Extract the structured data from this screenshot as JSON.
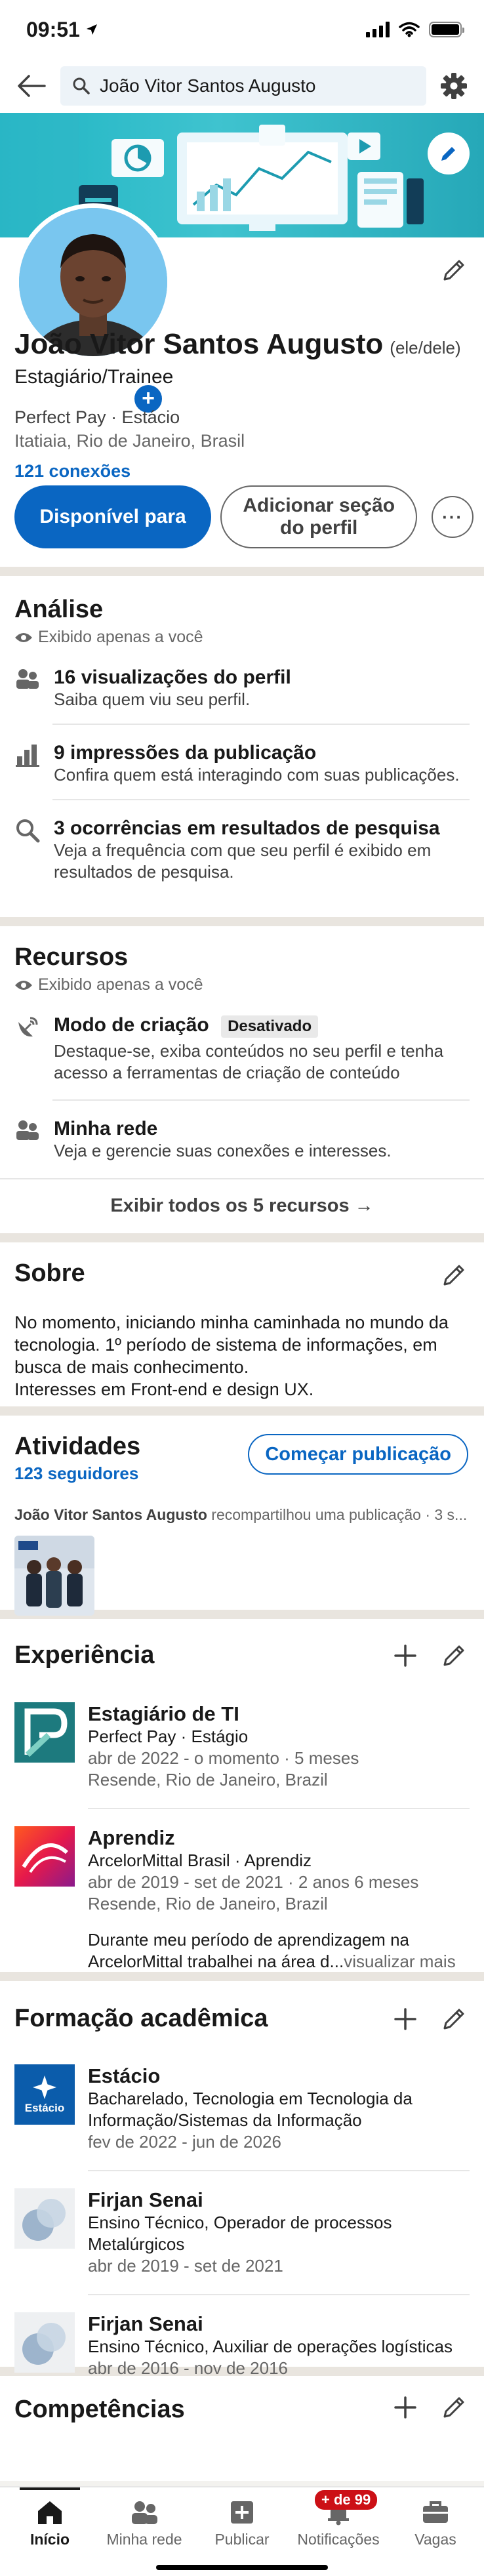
{
  "status_bar": {
    "time": "09:51"
  },
  "search": {
    "value": "João Vitor Santos Augusto"
  },
  "profile": {
    "name": "João Vitor Santos Augusto",
    "pronouns": "(ele/dele)",
    "headline": "Estagiário/Trainee",
    "company_school": "Perfect Pay · Estácio",
    "location": "Itatiaia, Rio de Janeiro, Brasil",
    "connections": "121 conexões",
    "open_to_button": "Disponível para",
    "add_section_button": "Adicionar seção do perfil"
  },
  "analytics": {
    "title": "Análise",
    "private_note": "Exibido apenas a você",
    "items": [
      {
        "title": "16 visualizações do perfil",
        "subtitle": "Saiba quem viu seu perfil."
      },
      {
        "title": "9 impressões da publicação",
        "subtitle": "Confira quem está interagindo com suas publicações."
      },
      {
        "title": "3 ocorrências em resultados de pesquisa",
        "subtitle": "Veja a frequência com que seu perfil é exibido em resultados de pesquisa."
      }
    ]
  },
  "resources": {
    "title": "Recursos",
    "private_note": "Exibido apenas a você",
    "creator_title": "Modo de criação",
    "creator_badge": "Desativado",
    "creator_sub": "Destaque-se, exiba conteúdos no seu perfil e tenha acesso a ferramentas de criação de conteúdo",
    "network_title": "Minha rede",
    "network_sub": "Veja e gerencie suas conexões e interesses.",
    "show_all": "Exibir todos os 5 recursos →"
  },
  "about": {
    "title": "Sobre",
    "text": "No momento, iniciando minha caminhada no mundo da tecnologia. 1º período de sistema de informações, em busca de mais conhecimento.",
    "text2": "Interesses em Front-end e design UX."
  },
  "activity": {
    "title": "Atividades",
    "followers": "123 seguidores",
    "start_post": "Começar publicação",
    "actor": "João Vitor Santos Augusto",
    "action": " recompartilhou uma publicação · 3 s..."
  },
  "experience": {
    "title": "Experiência",
    "items": [
      {
        "title": "Estagiário de TI",
        "company": "Perfect Pay · Estágio",
        "dates": "abr de 2022 - o momento · 5 meses",
        "location": "Resende, Rio de Janeiro, Brazil"
      },
      {
        "title": "Aprendiz",
        "company": "ArcelorMittal Brasil · Aprendiz",
        "dates": "abr de 2019 - set de 2021 · 2 anos 6 meses",
        "location": "Resende, Rio de Janeiro, Brazil",
        "description": "Durante meu período de aprendizagem na ArcelorMittal trabalhei na área d...",
        "see_more": "visualizar mais"
      }
    ]
  },
  "education": {
    "title": "Formação acadêmica",
    "items": [
      {
        "school": "Estácio",
        "logo_text": "Estácio",
        "degree": "Bacharelado, Tecnologia em Tecnologia da Informação/Sistemas da Informação",
        "dates": "fev de 2022 - jun de 2026"
      },
      {
        "school": "Firjan Senai",
        "degree": "Ensino Técnico, Operador de processos Metalúrgicos",
        "dates": "abr de 2019 - set de 2021"
      },
      {
        "school": "Firjan Senai",
        "degree": "Ensino Técnico, Auxiliar de operações logísticas",
        "dates": "abr de 2016 - nov de 2016"
      }
    ]
  },
  "skills": {
    "title": "Competências"
  },
  "bottom_nav": {
    "items": [
      {
        "label": "Início",
        "icon": "home-icon"
      },
      {
        "label": "Minha rede",
        "icon": "network-icon"
      },
      {
        "label": "Publicar",
        "icon": "post-icon"
      },
      {
        "label": "Notificações",
        "icon": "bell-icon"
      },
      {
        "label": "Vagas",
        "icon": "jobs-icon"
      }
    ],
    "notifications_badge": "+ de 99"
  },
  "colors": {
    "brand": "#0a66c2",
    "cover": "#26b3c3",
    "badge": "#cc1016"
  }
}
